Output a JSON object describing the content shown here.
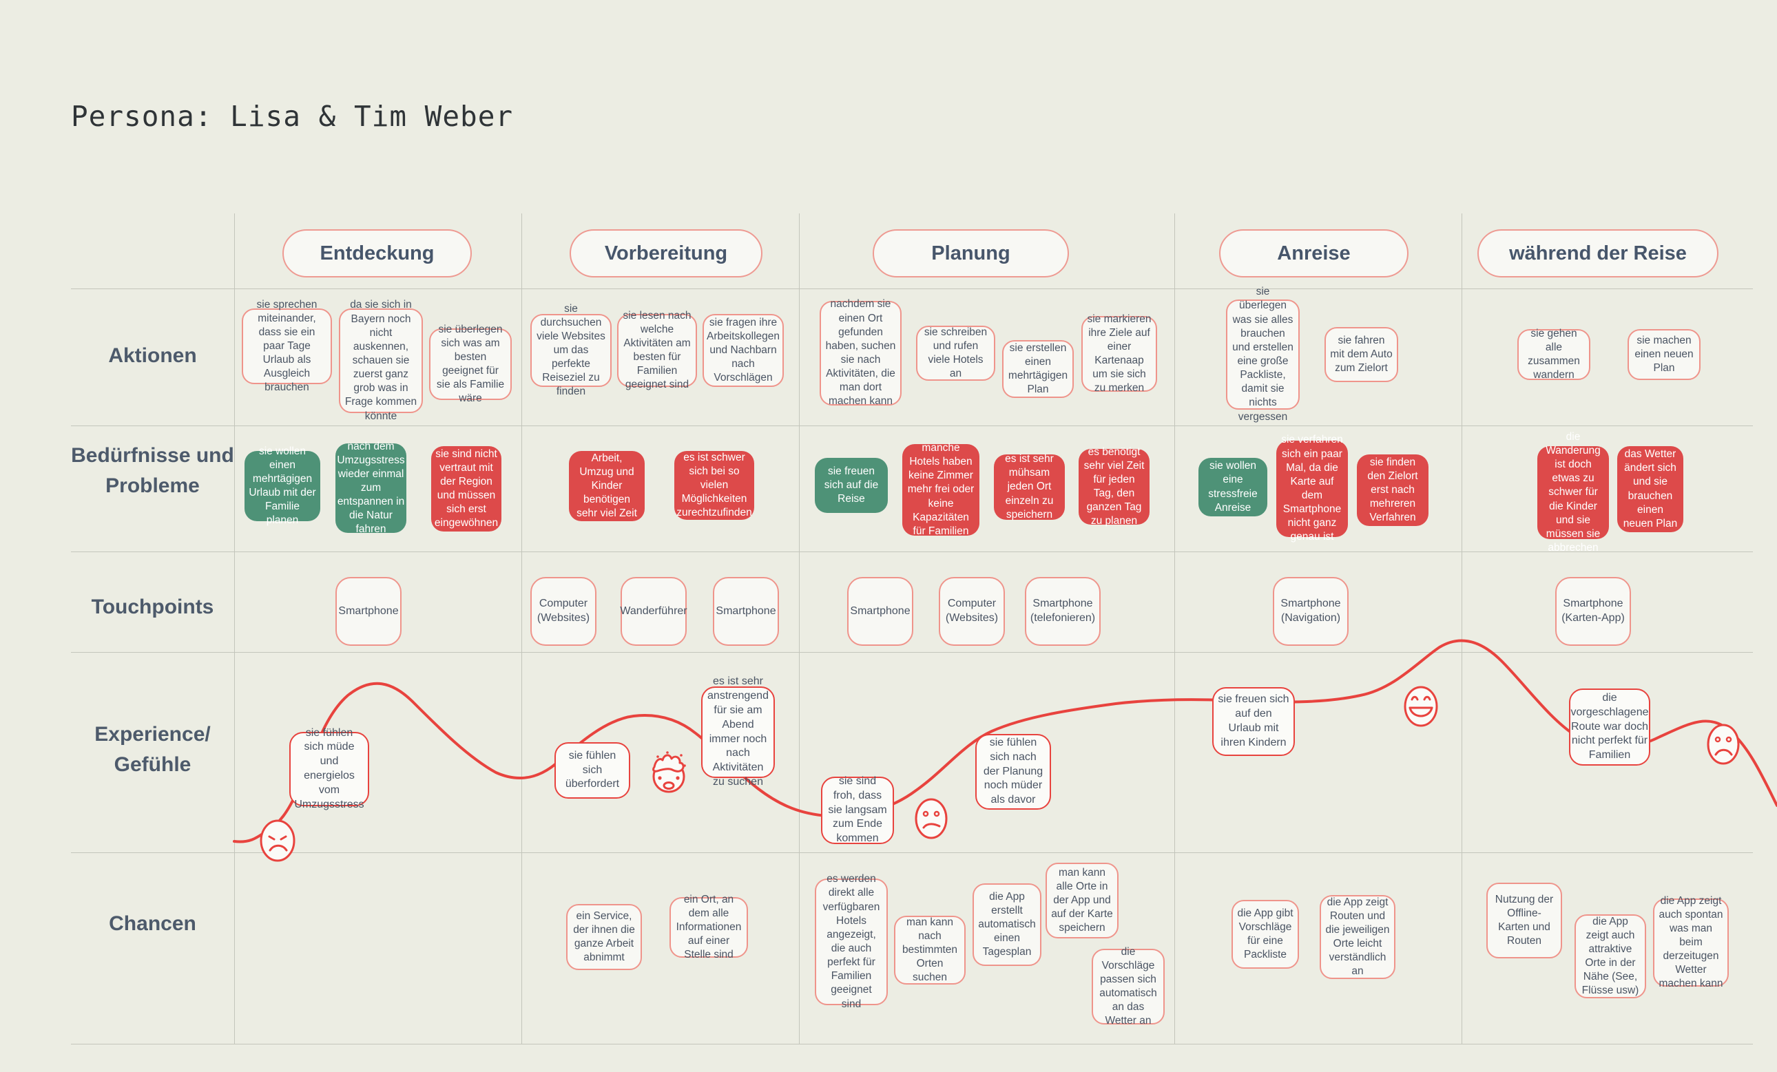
{
  "title": "Persona: Lisa & Tim Weber",
  "colors": {
    "background": "#ecede3",
    "accent_pink": "#ef948b",
    "curve_red": "#e8433e",
    "positive_green": "#4e9277",
    "negative_red": "#dd4a4a",
    "label_blue": "#4d5a6b",
    "grid_line": "#c3c5bb"
  },
  "phases": [
    {
      "label": "Entdeckung"
    },
    {
      "label": "Vorbereitung"
    },
    {
      "label": "Planung"
    },
    {
      "label": "Anreise"
    },
    {
      "label": "während der Reise"
    }
  ],
  "rows": [
    {
      "label": "Aktionen"
    },
    {
      "label": "Bedürfnisse und Probleme"
    },
    {
      "label": "Touchpoints"
    },
    {
      "label": "Experience/ Gefühle"
    },
    {
      "label": "Chancen"
    }
  ],
  "aktionen": [
    "sie sprechen miteinander, dass sie ein paar Tage Urlaub als Ausgleich brauchen",
    "da sie sich in Bayern noch nicht auskennen, schauen sie zuerst ganz grob was in Frage kommen könnte",
    "sie überlegen sich was am besten geeignet für sie als Familie wäre",
    "sie durchsuchen viele Websites um das perfekte Reiseziel zu finden",
    "sie lesen nach welche Aktivitäten am besten für Familien geeignet sind",
    "sie fragen ihre Arbeitskollegen und Nachbarn nach Vorschlägen",
    "nachdem sie einen Ort gefunden haben, suchen sie nach Aktivitäten, die man dort machen kann",
    "sie schreiben und rufen viele Hotels an",
    "sie erstellen einen mehrtägigen Plan",
    "sie markieren ihre Ziele auf einer Kartenaap um sie sich zu merken",
    "sie überlegen was sie alles brauchen und erstellen eine große Packliste, damit sie nichts vergessen",
    "sie fahren mit dem Auto zum Zielort",
    "sie gehen alle zusammen wandern",
    "sie machen einen neuen Plan"
  ],
  "beduerfnisse": [
    {
      "text": "sie wollen einen mehrtägigen Urlaub mit der Familie planen",
      "type": "positive"
    },
    {
      "text": "nach dem Umzugsstress wieder einmal zum entspannen in die Natur fahren",
      "type": "positive"
    },
    {
      "text": "sie sind nicht vertraut mit der Region und müssen sich erst eingewöhnen",
      "type": "negative"
    },
    {
      "text": "Arbeit, Umzug und Kinder benötigen sehr viel Zeit",
      "type": "negative"
    },
    {
      "text": "es ist schwer sich bei so vielen Möglichkeiten zurechtzufinden",
      "type": "negative"
    },
    {
      "text": "sie freuen sich auf die Reise",
      "type": "positive"
    },
    {
      "text": "manche Hotels haben keine Zimmer mehr frei oder keine Kapazitäten für Familien",
      "type": "negative"
    },
    {
      "text": "es ist sehr mühsam jeden Ort einzeln zu speichern",
      "type": "negative"
    },
    {
      "text": "es benötigt sehr viel Zeit für jeden Tag, den ganzen Tag zu planen",
      "type": "negative"
    },
    {
      "text": "sie wollen eine stressfreie Anreise",
      "type": "positive"
    },
    {
      "text": "sie verfahren sich ein paar Mal, da die Karte auf dem Smartphone nicht ganz genau ist",
      "type": "negative"
    },
    {
      "text": "sie finden den Zielort erst nach mehreren Verfahren",
      "type": "negative"
    },
    {
      "text": "die Wanderung ist doch etwas zu schwer für die Kinder und sie müssen sie abbrechen",
      "type": "negative"
    },
    {
      "text": "das Wetter ändert sich und sie brauchen einen neuen Plan",
      "type": "negative"
    }
  ],
  "touchpoints": [
    "Smartphone",
    "Computer (Websites)",
    "Wanderführer",
    "Smartphone",
    "Smartphone",
    "Computer (Websites)",
    "Smartphone (telefonieren)",
    "Smartphone (Navigation)",
    "Smartphone (Karten-App)"
  ],
  "experience": {
    "notes": [
      "sie fühlen sich müde und energielos vom Umzugsstress",
      "sie fühlen sich überfordert",
      "es ist sehr anstrengend für sie am Abend immer noch nach Aktivitäten zu suchen",
      "sie sind froh, dass sie langsam zum Ende kommen",
      "sie fühlen sich nach der Planung noch müder als davor",
      "sie freuen sich auf den Urlaub mit ihren Kindern",
      "die vorgeschlagene Route war doch nicht perfekt für Familien"
    ],
    "emojis": [
      {
        "name": "sad-face-icon",
        "mood": "sad"
      },
      {
        "name": "exploding-head-icon",
        "mood": "overwhelmed"
      },
      {
        "name": "confused-face-icon",
        "mood": "confused"
      },
      {
        "name": "grinning-face-icon",
        "mood": "happy"
      },
      {
        "name": "frowning-face-icon",
        "mood": "sad"
      }
    ]
  },
  "chancen": [
    "ein Service, der ihnen die ganze Arbeit abnimmt",
    "ein Ort, an dem alle Informationen auf einer Stelle sind",
    "es werden direkt alle verfügbaren Hotels angezeigt, die auch perfekt für Familien geeignet sind",
    "man kann nach bestimmten Orten suchen",
    "die App erstellt automatisch einen Tagesplan",
    "man kann alle Orte in der App und auf der Karte speichern",
    "die Vorschläge passen sich automatisch an das Wetter an",
    "die App gibt Vorschläge für eine Packliste",
    "die App zeigt Routen und die jeweiligen Orte leicht verständlich an",
    "Nutzung der Offline-Karten und Routen",
    "die App zeigt auch attraktive Orte in der Nähe (See, Flüsse usw)",
    "die App zeigt auch spontan was man beim derzeitugen Wetter machen kann"
  ]
}
